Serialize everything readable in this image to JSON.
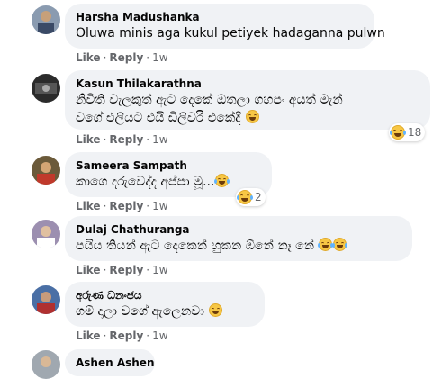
{
  "actions": {
    "like": "Like",
    "reply": "Reply",
    "separator": "·",
    "time": "1w"
  },
  "comments": [
    {
      "author": "Harsha Madushanka",
      "text": "Oluwa minis aga kukul petiyek hadaganna pulwn",
      "reaction_count": ""
    },
    {
      "author": "Kasun Thilakarathna",
      "text_line1": "නිවිති වැලකුත් ඇට දෙකේ ඔතලා ගහපං අයත් මැන්",
      "text_line2": "වගේ එලියට එයි ඩිලිවරි එකේදි",
      "reaction_count": "18"
    },
    {
      "author": "Sameera Sampath",
      "text": "කාගෙ දරුවෙද්ද අප්පා මූ...",
      "reaction_count": "2"
    },
    {
      "author": "Dulaj Chathuranga",
      "text": "පයිය තියන් ඇට දෙකෙන් හුකන ඕනේ නෑ නේ",
      "reaction_count": ""
    },
    {
      "author": "අරුණ ධනංජය",
      "text": "ගම් දාලා වගේ ඇලෙනවා",
      "reaction_count": ""
    },
    {
      "author": "Ashen Ashen",
      "text": ""
    }
  ]
}
